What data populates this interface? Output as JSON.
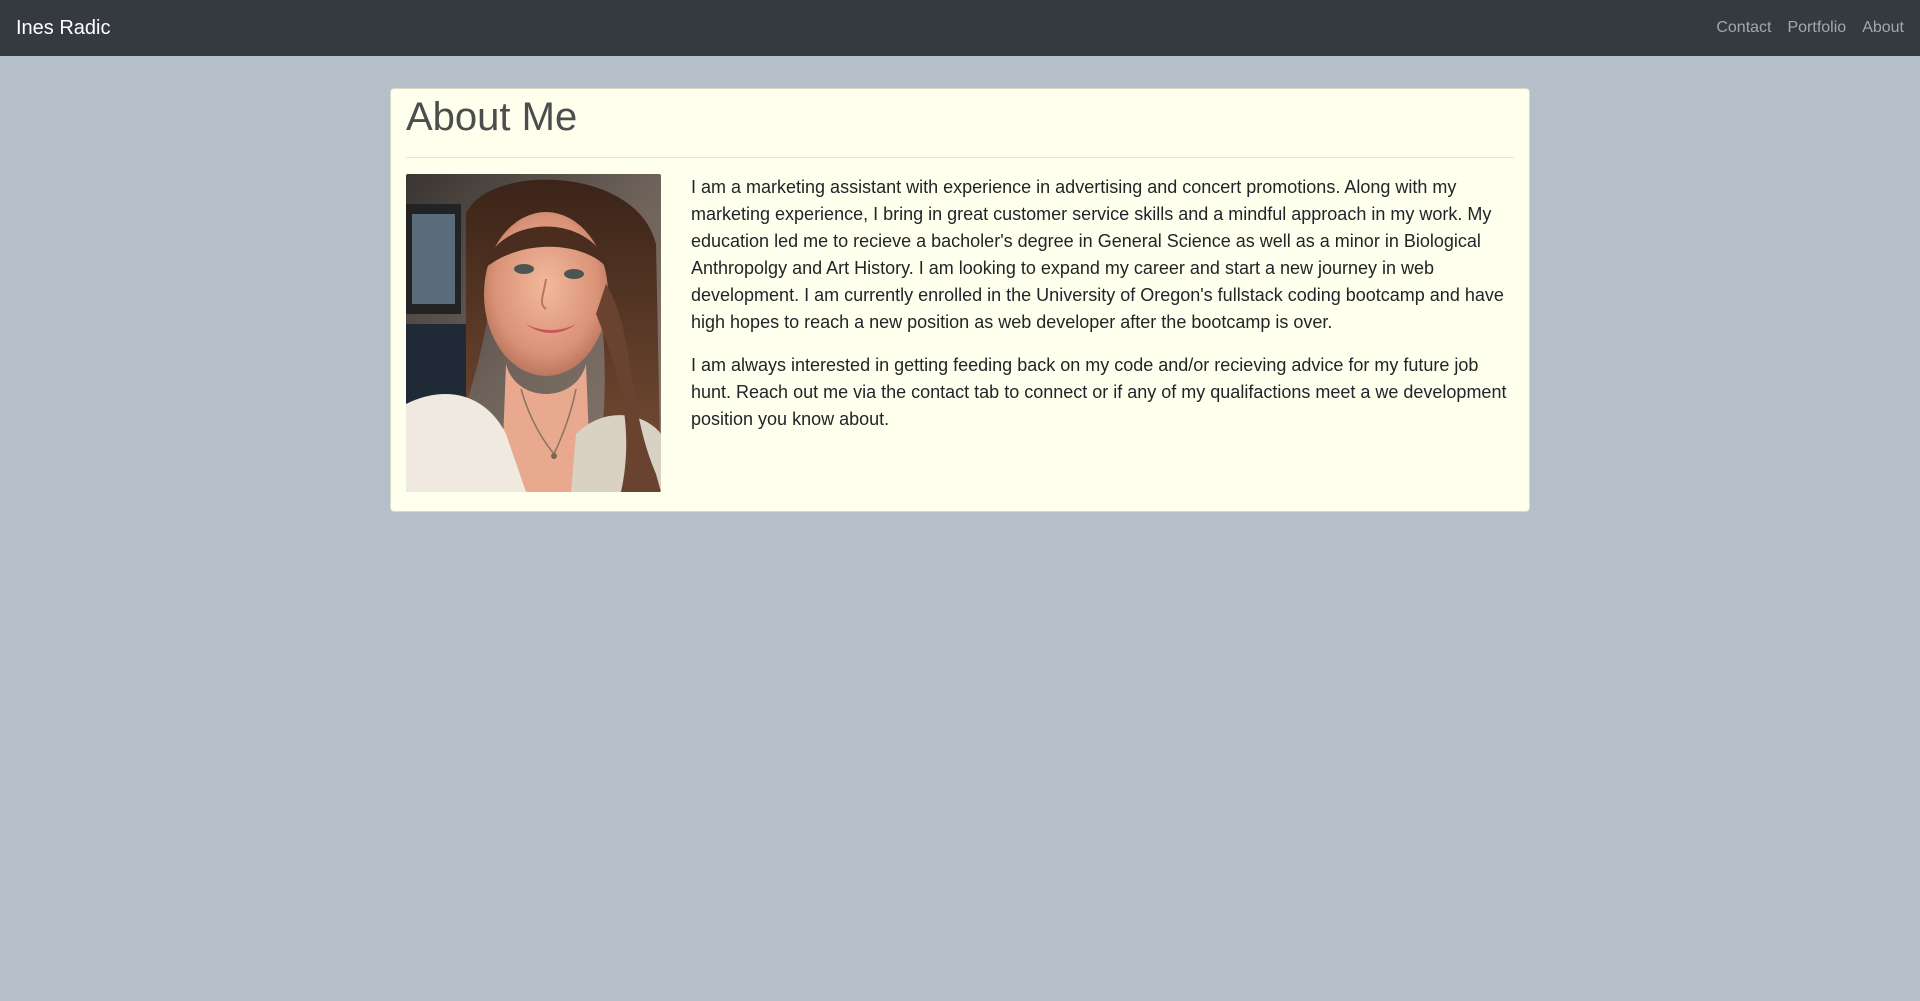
{
  "navbar": {
    "brand": "Ines Radic",
    "links": [
      "Contact",
      "Portfolio",
      "About"
    ]
  },
  "about": {
    "title": "About Me",
    "paragraphs": [
      "I am a marketing assistant with experience in advertising and concert promotions. Along with my marketing experience, I bring in great customer service skills and a mindful approach in my work. My education led me to recieve a bacholer's degree in General Science as well as a minor in Biological Anthropolgy and Art History. I am looking to expand my career and start a new journey in web development. I am currently enrolled in the University of Oregon's fullstack coding bootcamp and have high hopes to reach a new position as web developer after the bootcamp is over.",
      "I am always interested in getting feeding back on my code and/or recieving advice for my future job hunt. Reach out me via the contact tab to connect or if any of my qualifactions meet a we development position you know about."
    ]
  },
  "colors": {
    "navbar_bg": "#343a40",
    "page_bg": "#b5bfca",
    "card_bg": "#ffffee"
  }
}
